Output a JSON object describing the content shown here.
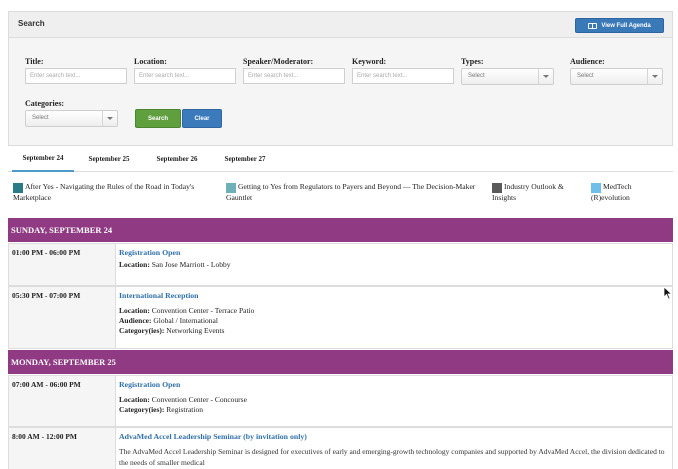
{
  "search": {
    "title": "Search",
    "agenda_button": "View Full Agenda",
    "fields": [
      {
        "label": "Title:",
        "placeholder": "Enter search text..."
      },
      {
        "label": "Location:",
        "placeholder": "Enter search text..."
      },
      {
        "label": "Speaker/Moderator:",
        "placeholder": "Enter search text..."
      },
      {
        "label": "Keyword:",
        "placeholder": "Enter search text..."
      }
    ],
    "types": {
      "label": "Types:",
      "value": "Select"
    },
    "audience": {
      "label": "Audience:",
      "value": "Select"
    },
    "categories": {
      "label": "Categories:",
      "value": "Select"
    },
    "search_button": "Search",
    "clear_button": "Clear"
  },
  "tabs": [
    "September 24",
    "September 25",
    "September 26",
    "September 27"
  ],
  "legend": [
    {
      "text": "After Yes - Navigating the Rules of the Road in Today's Marketplace",
      "color": "#2a7a8a"
    },
    {
      "text": "Getting to Yes from Regulators to Payers and Beyond — The Decision-Maker Gauntlet",
      "color": "#6fb0b8"
    },
    {
      "text": "Industry Outlook & Insights",
      "color": "#5a5a5a"
    },
    {
      "text": "MedTech (R)evolution",
      "color": "#6ec0ea"
    }
  ],
  "days": [
    {
      "header": "SUNDAY, SEPTEMBER 24",
      "events": [
        {
          "time": "01:00 PM  - 06:00 PM",
          "title": "Registration Open",
          "location_label": "Location:",
          "location": "San Jose Marriott - Lobby"
        },
        {
          "time": "05:30 PM  - 07:00 PM",
          "title": "International Reception",
          "location_label": "Location:",
          "location": "Convention Center - Terrace Patio",
          "audience_label": "Audience:",
          "audience": "Global / International",
          "category_label": "Category(ies):",
          "category": "Networking Events"
        }
      ]
    },
    {
      "header": "MONDAY, SEPTEMBER 25",
      "events": [
        {
          "time": "07:00 AM  - 06:00 PM",
          "title": "Registration Open",
          "location_label": "Location:",
          "location": "Convention Center - Concourse",
          "category_label": "Category(ies):",
          "category": "Registration"
        },
        {
          "time": "8:00 AM  - 12:00 PM",
          "title": "AdvaMed Accel Leadership Seminar (by invitation only)",
          "description": "The AdvaMed Accel Leadership Seminar is designed for executives of early and emerging-growth technology companies and supported by AdvaMed Accel, the division dedicated to the needs of smaller medical"
        }
      ]
    }
  ]
}
